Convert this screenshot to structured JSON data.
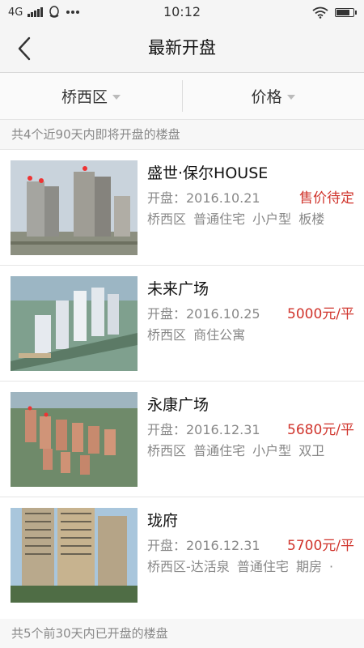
{
  "status_bar": {
    "network": "4G",
    "time": "10:12",
    "battery_level": 0.85,
    "icons": [
      "signal-icon",
      "qq-icon",
      "more-dots-icon",
      "wifi-icon",
      "battery-icon"
    ]
  },
  "nav": {
    "title": "最新开盘",
    "back_icon": "back-arrow-icon"
  },
  "filters": [
    {
      "label": "桥西区",
      "icon": "caret-down-icon"
    },
    {
      "label": "价格",
      "icon": "caret-down-icon"
    }
  ],
  "upcoming_summary": "共4个近90天内即将开盘的楼盘",
  "projects": [
    {
      "name": "盛世·保尔HOUSE",
      "open_date": "开盘：2016.10.21",
      "price": "售价待定",
      "tags": "桥西区 普通住宅 小户型 板楼"
    },
    {
      "name": "未来广场",
      "open_date": "开盘：2016.10.25",
      "price": "5000元/平",
      "tags": "桥西区 商住公寓"
    },
    {
      "name": "永康广场",
      "open_date": "开盘：2016.12.31",
      "price": "5680元/平",
      "tags": "桥西区 普通住宅 小户型 双卫"
    },
    {
      "name": "珑府",
      "open_date": "开盘：2016.12.31",
      "price": "5700元/平",
      "tags": "桥西区-达活泉 普通住宅 期房 ·"
    }
  ],
  "opened_summary": "共5个前30天内已开盘的楼盘",
  "colors": {
    "price_red": "#d0342c",
    "muted_gray": "#888888",
    "bar_bg": "#f5f5f5"
  }
}
